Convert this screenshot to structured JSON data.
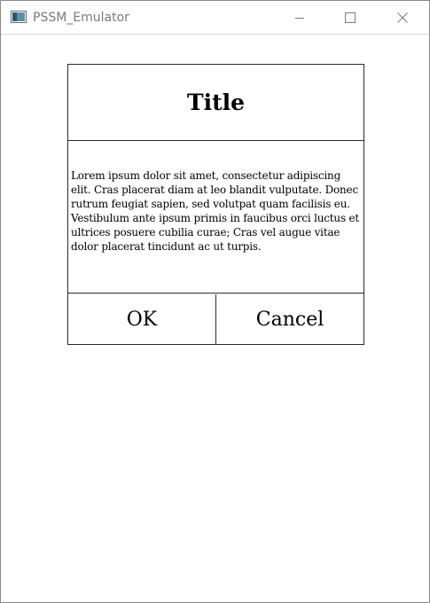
{
  "window": {
    "title": "PSSM_Emulator",
    "controls": {
      "minimize": "minimize-icon",
      "maximize": "maximize-icon",
      "close": "close-icon"
    }
  },
  "dialog": {
    "title": "Title",
    "body": "Lorem ipsum dolor sit amet, consectetur adipiscing elit. Cras placerat diam at leo blandit vulputate. Donec rutrum feugiat sapien, sed volutpat quam facilisis eu. Vestibulum ante ipsum primis in faucibus orci luctus et ultrices posuere cubilia curae; Cras vel augue vitae dolor placerat tincidunt ac ut turpis.",
    "ok_label": "OK",
    "cancel_label": "Cancel"
  },
  "colors": {
    "border": "#2b2b2b",
    "title_text": "#7a7a7a",
    "background": "#ffffff"
  }
}
